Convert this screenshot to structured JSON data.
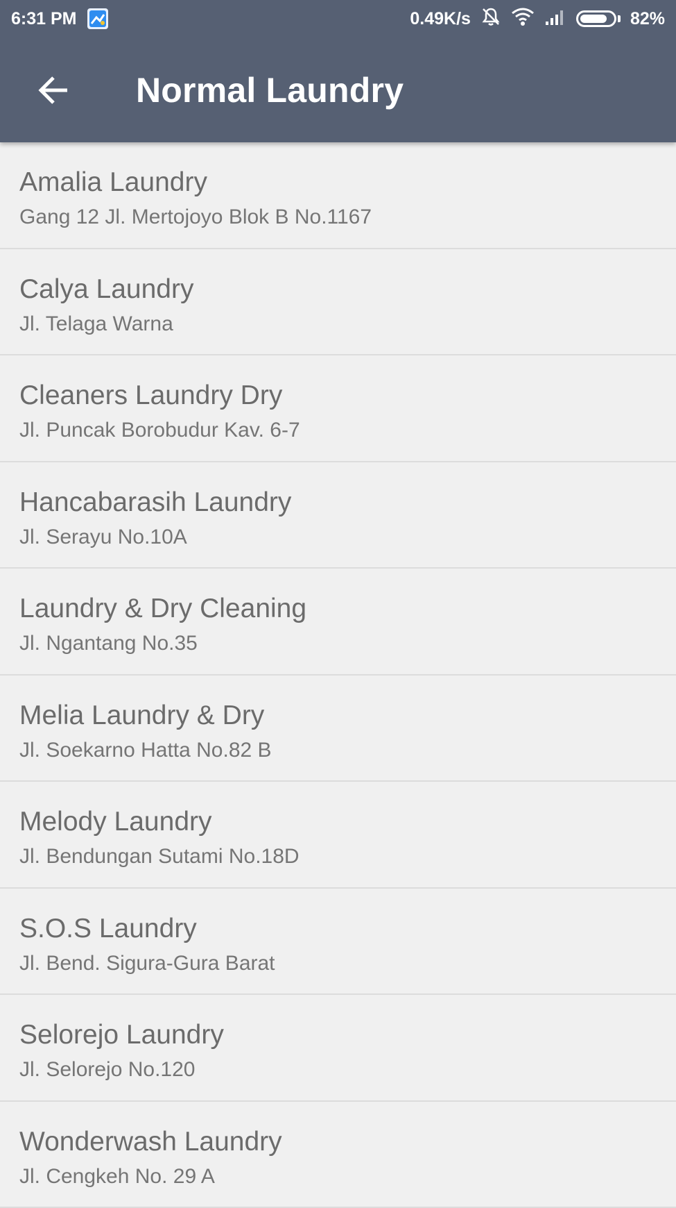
{
  "status_bar": {
    "time": "6:31 PM",
    "network_speed": "0.49K/s",
    "battery_percent": "82%",
    "battery_level": 0.82,
    "icons": [
      "notification-app-icon",
      "muted-bell-icon",
      "wifi-icon",
      "cell-signal-icon",
      "battery-icon"
    ]
  },
  "app_bar": {
    "title": "Normal Laundry",
    "back_icon": "arrow-left-icon",
    "background": "#566073"
  },
  "laundries": [
    {
      "name": "Amalia Laundry",
      "address": "Gang 12 Jl. Mertojoyo Blok B No.1167"
    },
    {
      "name": "Calya Laundry",
      "address": "Jl. Telaga Warna"
    },
    {
      "name": "Cleaners Laundry Dry",
      "address": "Jl. Puncak Borobudur Kav. 6-7"
    },
    {
      "name": "Hancabarasih Laundry",
      "address": "Jl. Serayu No.10A"
    },
    {
      "name": "Laundry & Dry Cleaning",
      "address": "Jl. Ngantang No.35"
    },
    {
      "name": "Melia Laundry & Dry",
      "address": "Jl. Soekarno Hatta No.82 B"
    },
    {
      "name": "Melody Laundry",
      "address": "Jl. Bendungan Sutami No.18D"
    },
    {
      "name": "S.O.S Laundry",
      "address": "Jl. Bend. Sigura-Gura Barat"
    },
    {
      "name": "Selorejo Laundry",
      "address": "Jl. Selorejo No.120"
    },
    {
      "name": "Wonderwash Laundry",
      "address": "Jl. Cengkeh No. 29 A"
    }
  ],
  "colors": {
    "app_bar": "#566073",
    "list_background": "#f0f0f0",
    "divider": "#dcdcdc",
    "title_text": "#6b6b6b",
    "subtitle_text": "#757575"
  }
}
